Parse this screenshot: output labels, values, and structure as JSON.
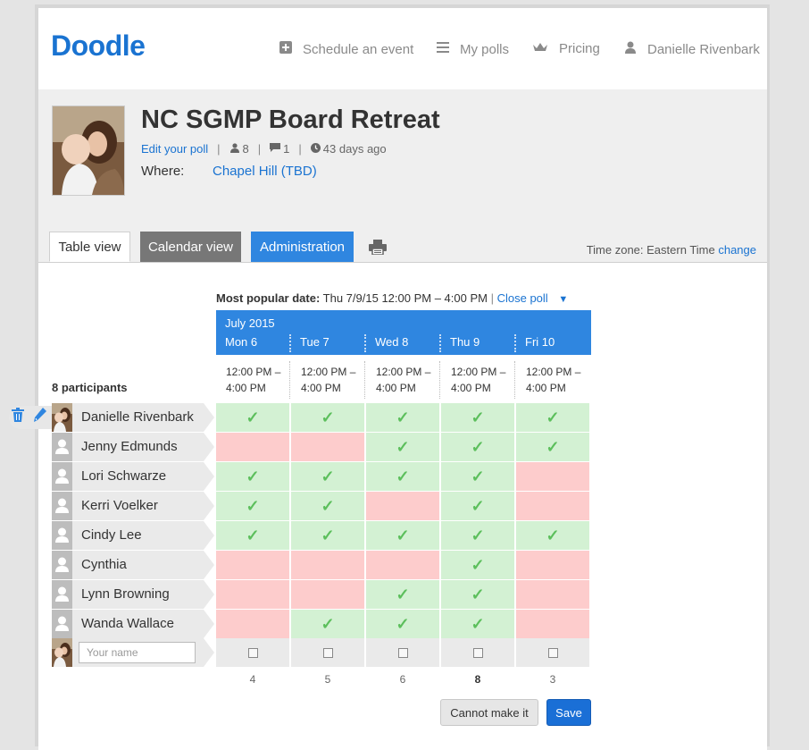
{
  "header": {
    "logo": "Doodle",
    "nav": [
      {
        "label": "Schedule an event",
        "icon": "plus-icon"
      },
      {
        "label": "My polls",
        "icon": "menu-icon"
      },
      {
        "label": "Pricing",
        "icon": "crown-icon"
      },
      {
        "label": "Danielle Rivenbark",
        "icon": "user-icon"
      }
    ]
  },
  "poll": {
    "title": "NC SGMP Board Retreat",
    "edit_link": "Edit your poll",
    "participant_count": "8",
    "comment_count": "1",
    "age": "43 days ago",
    "where_label": "Where:",
    "where_value": "Chapel Hill (TBD)"
  },
  "tabs": {
    "table_view": "Table view",
    "calendar_view": "Calendar view",
    "administration": "Administration"
  },
  "timezone": {
    "label": "Time zone: Eastern Time",
    "change": "change"
  },
  "popular": {
    "label": "Most popular date:",
    "value": "Thu 7/9/15 12:00 PM – 4:00 PM",
    "separator": "|",
    "close": "Close poll"
  },
  "calendar": {
    "month": "July 2015",
    "days": [
      "Mon 6",
      "Tue 7",
      "Wed 8",
      "Thu 9",
      "Fri 10"
    ],
    "time_line1": "12:00 PM –",
    "time_line2": "4:00 PM"
  },
  "participants_label": "8 participants",
  "participants": [
    {
      "name": "Danielle Rivenbark",
      "answers": [
        true,
        true,
        true,
        true,
        true
      ]
    },
    {
      "name": "Jenny Edmunds",
      "answers": [
        false,
        false,
        true,
        true,
        true
      ]
    },
    {
      "name": "Lori Schwarze",
      "answers": [
        true,
        true,
        true,
        true,
        false
      ]
    },
    {
      "name": "Kerri Voelker",
      "answers": [
        true,
        true,
        false,
        true,
        false
      ]
    },
    {
      "name": "Cindy Lee",
      "answers": [
        true,
        true,
        true,
        true,
        true
      ]
    },
    {
      "name": "Cynthia",
      "answers": [
        false,
        false,
        false,
        true,
        false
      ]
    },
    {
      "name": "Lynn Browning",
      "answers": [
        false,
        false,
        true,
        true,
        false
      ]
    },
    {
      "name": "Wanda Wallace",
      "answers": [
        false,
        true,
        true,
        true,
        false
      ]
    }
  ],
  "new_entry": {
    "placeholder": "Your name"
  },
  "totals": [
    "4",
    "5",
    "6",
    "8",
    "3"
  ],
  "buttons": {
    "cannot": "Cannot make it",
    "save": "Save"
  },
  "colors": {
    "brand": "#1a73d1",
    "header_blue": "#2f86e0",
    "yes": "#d3f1d3",
    "no": "#fdcccc",
    "check": "#5cbf5c"
  }
}
